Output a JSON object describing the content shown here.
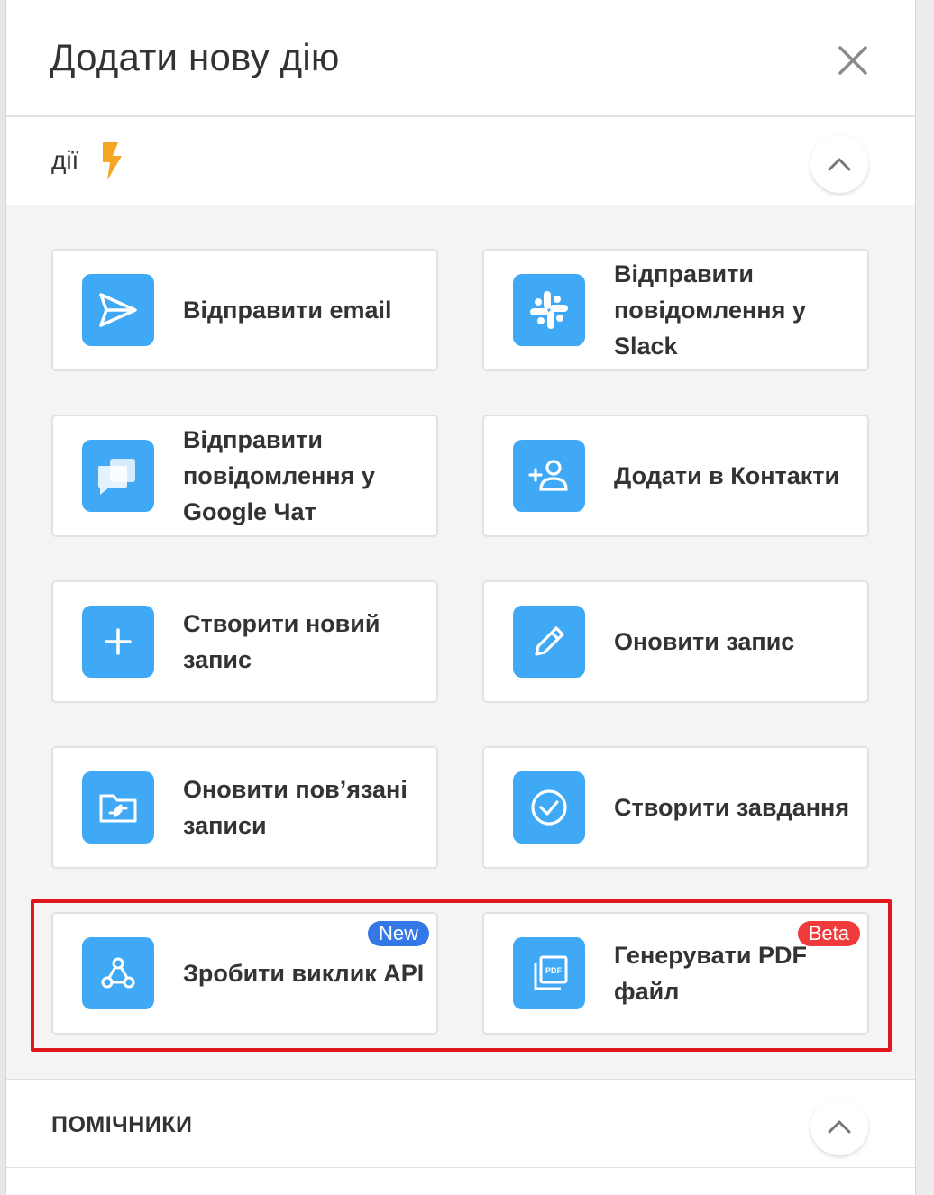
{
  "dialog": {
    "title": "Додати нову дію"
  },
  "actions_section": {
    "title": "дії",
    "items": [
      {
        "label": "Відправити email",
        "icon": "send-icon"
      },
      {
        "label": "Відправити повідомлення у Slack",
        "icon": "slack-icon"
      },
      {
        "label": "Відправити повідомлення у Google Чат",
        "icon": "chat-icon"
      },
      {
        "label": "Додати в Контакти",
        "icon": "add-contact-icon"
      },
      {
        "label": "Створити новий запис",
        "icon": "plus-icon"
      },
      {
        "label": "Оновити запис",
        "icon": "pencil-icon"
      },
      {
        "label": "Оновити пов’язані записи",
        "icon": "folder-transfer-icon"
      },
      {
        "label": "Створити завдання",
        "icon": "check-circle-icon"
      },
      {
        "label": "Зробити виклик API",
        "icon": "webhook-icon",
        "badge": "New"
      },
      {
        "label": "Генерувати PDF файл",
        "icon": "pdf-icon",
        "badge": "Beta"
      }
    ]
  },
  "helpers_section": {
    "title": "ПОМІЧНИКИ"
  },
  "colors": {
    "icon_background": "#3fa9f5",
    "bolt": "#f5a623",
    "badge_new": "#3378e6",
    "badge_beta": "#ef3b3b",
    "highlight_border": "#e0161c"
  }
}
